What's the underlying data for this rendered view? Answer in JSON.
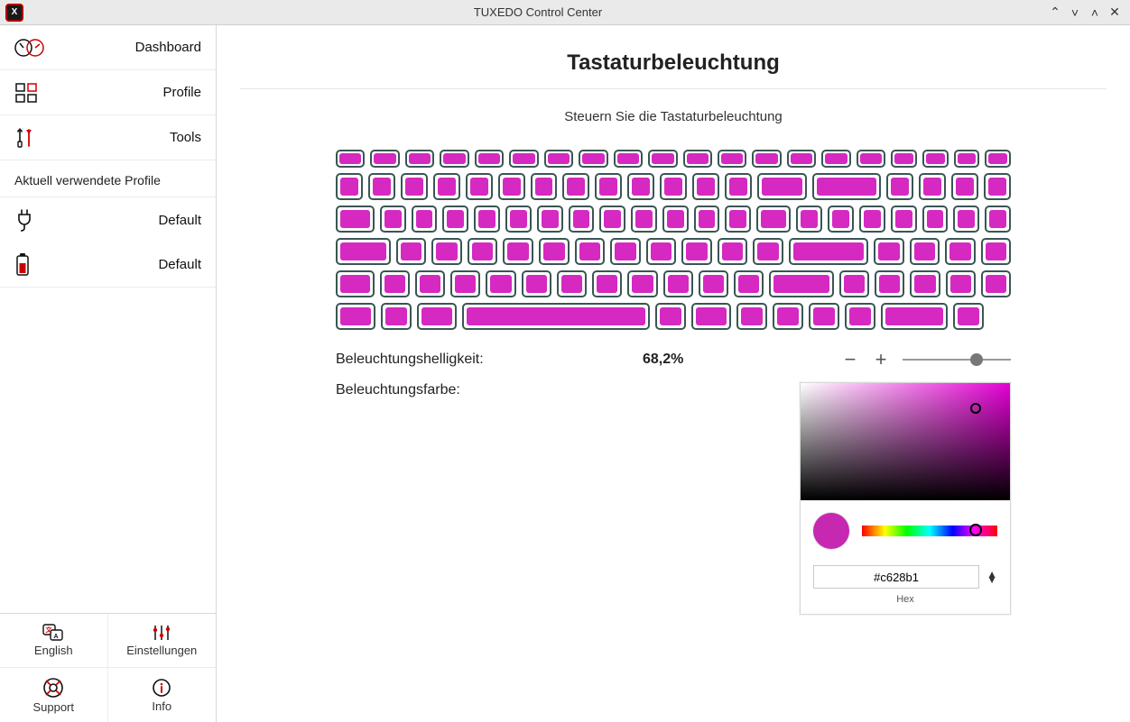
{
  "window": {
    "title": "TUXEDO Control Center"
  },
  "sidebar": {
    "items": [
      {
        "label": "Dashboard"
      },
      {
        "label": "Profile"
      },
      {
        "label": "Tools"
      }
    ],
    "profiles_header": "Aktuell verwendete Profile",
    "profiles": [
      {
        "label": "Default"
      },
      {
        "label": "Default"
      }
    ],
    "bottom": {
      "english": "English",
      "settings": "Einstellungen",
      "support": "Support",
      "info": "Info"
    }
  },
  "page": {
    "title": "Tastaturbeleuchtung",
    "subtitle": "Steuern Sie die Tastaturbeleuchtung"
  },
  "backlight": {
    "brightness_label": "Beleuchtungshelligkeit:",
    "brightness_value": "68,2%",
    "brightness_percent": 68.2,
    "color_label": "Beleuchtungsfarbe:",
    "hex_value": "#c628b1",
    "hex_type_label": "Hex",
    "key_color": "#d629c1"
  }
}
